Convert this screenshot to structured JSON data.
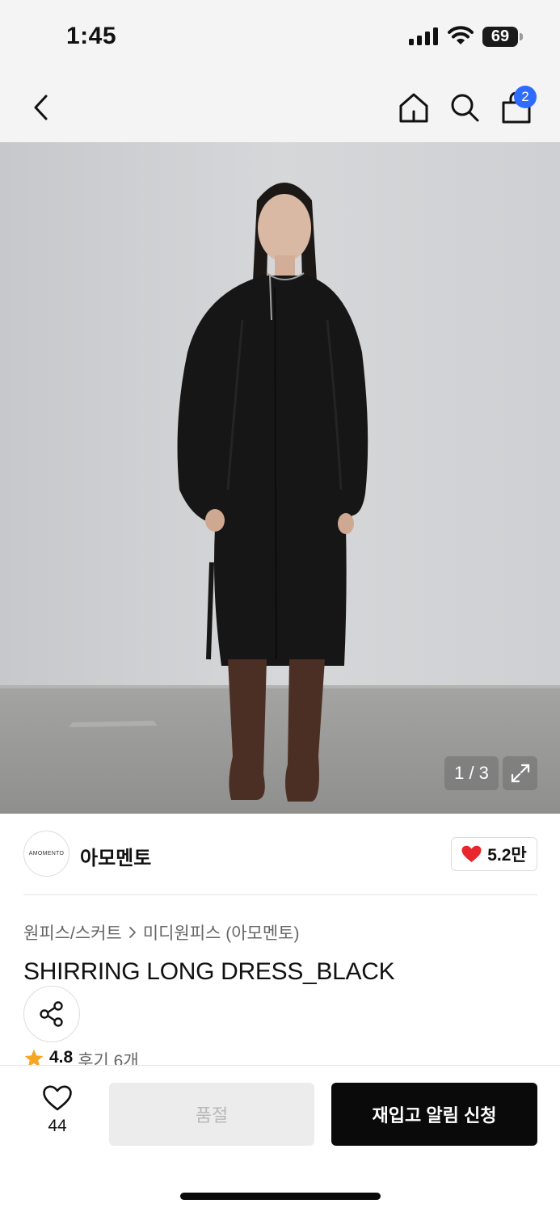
{
  "status_bar": {
    "time": "1:45",
    "battery": "69"
  },
  "nav": {
    "back_icon": "chevron-left-icon",
    "home_icon": "home-icon",
    "search_icon": "search-icon",
    "cart_icon": "shopping-bag-icon",
    "cart_count": "2"
  },
  "gallery": {
    "pager": "1 / 3",
    "expand_icon": "expand-icon"
  },
  "brand": {
    "logo_text": "AMOMENTO",
    "name": "아모멘토",
    "likes": "5.2만",
    "heart_color": "#e8262d"
  },
  "product": {
    "breadcrumb": [
      "원피스/스커트",
      "미디원피스 (아모멘토)"
    ],
    "title": "SHIRRING LONG DRESS_BLACK",
    "rating": "4.8",
    "reviews": "후기 6개",
    "star_color": "#f5a623"
  },
  "bottom_bar": {
    "wish_count": "44",
    "soldout_label": "품절",
    "restock_label": "재입고 알림 신청"
  },
  "colors": {
    "accent_blue": "#2f6bff",
    "primary_black": "#0a0a0a"
  }
}
